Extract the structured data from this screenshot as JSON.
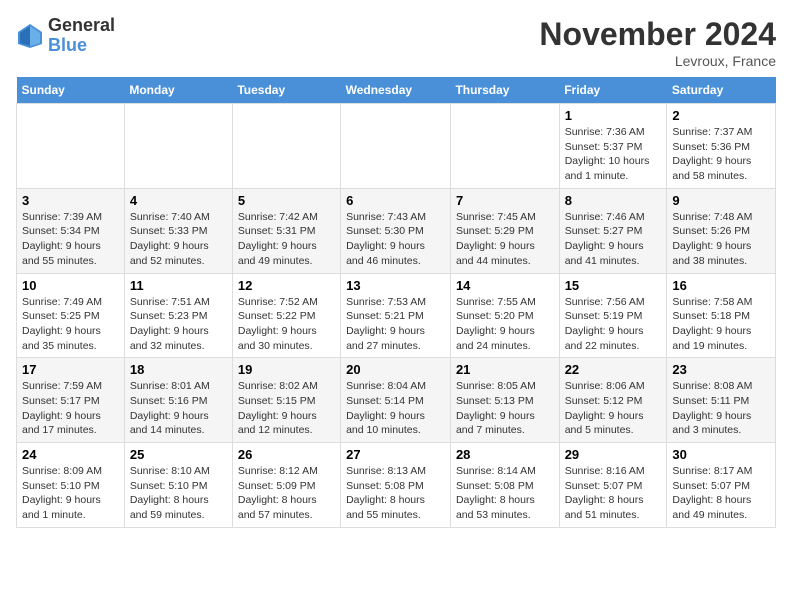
{
  "header": {
    "logo_line1": "General",
    "logo_line2": "Blue",
    "month_title": "November 2024",
    "location": "Levroux, France"
  },
  "weekdays": [
    "Sunday",
    "Monday",
    "Tuesday",
    "Wednesday",
    "Thursday",
    "Friday",
    "Saturday"
  ],
  "weeks": [
    [
      {
        "day": "",
        "info": ""
      },
      {
        "day": "",
        "info": ""
      },
      {
        "day": "",
        "info": ""
      },
      {
        "day": "",
        "info": ""
      },
      {
        "day": "",
        "info": ""
      },
      {
        "day": "1",
        "info": "Sunrise: 7:36 AM\nSunset: 5:37 PM\nDaylight: 10 hours and 1 minute."
      },
      {
        "day": "2",
        "info": "Sunrise: 7:37 AM\nSunset: 5:36 PM\nDaylight: 9 hours and 58 minutes."
      }
    ],
    [
      {
        "day": "3",
        "info": "Sunrise: 7:39 AM\nSunset: 5:34 PM\nDaylight: 9 hours and 55 minutes."
      },
      {
        "day": "4",
        "info": "Sunrise: 7:40 AM\nSunset: 5:33 PM\nDaylight: 9 hours and 52 minutes."
      },
      {
        "day": "5",
        "info": "Sunrise: 7:42 AM\nSunset: 5:31 PM\nDaylight: 9 hours and 49 minutes."
      },
      {
        "day": "6",
        "info": "Sunrise: 7:43 AM\nSunset: 5:30 PM\nDaylight: 9 hours and 46 minutes."
      },
      {
        "day": "7",
        "info": "Sunrise: 7:45 AM\nSunset: 5:29 PM\nDaylight: 9 hours and 44 minutes."
      },
      {
        "day": "8",
        "info": "Sunrise: 7:46 AM\nSunset: 5:27 PM\nDaylight: 9 hours and 41 minutes."
      },
      {
        "day": "9",
        "info": "Sunrise: 7:48 AM\nSunset: 5:26 PM\nDaylight: 9 hours and 38 minutes."
      }
    ],
    [
      {
        "day": "10",
        "info": "Sunrise: 7:49 AM\nSunset: 5:25 PM\nDaylight: 9 hours and 35 minutes."
      },
      {
        "day": "11",
        "info": "Sunrise: 7:51 AM\nSunset: 5:23 PM\nDaylight: 9 hours and 32 minutes."
      },
      {
        "day": "12",
        "info": "Sunrise: 7:52 AM\nSunset: 5:22 PM\nDaylight: 9 hours and 30 minutes."
      },
      {
        "day": "13",
        "info": "Sunrise: 7:53 AM\nSunset: 5:21 PM\nDaylight: 9 hours and 27 minutes."
      },
      {
        "day": "14",
        "info": "Sunrise: 7:55 AM\nSunset: 5:20 PM\nDaylight: 9 hours and 24 minutes."
      },
      {
        "day": "15",
        "info": "Sunrise: 7:56 AM\nSunset: 5:19 PM\nDaylight: 9 hours and 22 minutes."
      },
      {
        "day": "16",
        "info": "Sunrise: 7:58 AM\nSunset: 5:18 PM\nDaylight: 9 hours and 19 minutes."
      }
    ],
    [
      {
        "day": "17",
        "info": "Sunrise: 7:59 AM\nSunset: 5:17 PM\nDaylight: 9 hours and 17 minutes."
      },
      {
        "day": "18",
        "info": "Sunrise: 8:01 AM\nSunset: 5:16 PM\nDaylight: 9 hours and 14 minutes."
      },
      {
        "day": "19",
        "info": "Sunrise: 8:02 AM\nSunset: 5:15 PM\nDaylight: 9 hours and 12 minutes."
      },
      {
        "day": "20",
        "info": "Sunrise: 8:04 AM\nSunset: 5:14 PM\nDaylight: 9 hours and 10 minutes."
      },
      {
        "day": "21",
        "info": "Sunrise: 8:05 AM\nSunset: 5:13 PM\nDaylight: 9 hours and 7 minutes."
      },
      {
        "day": "22",
        "info": "Sunrise: 8:06 AM\nSunset: 5:12 PM\nDaylight: 9 hours and 5 minutes."
      },
      {
        "day": "23",
        "info": "Sunrise: 8:08 AM\nSunset: 5:11 PM\nDaylight: 9 hours and 3 minutes."
      }
    ],
    [
      {
        "day": "24",
        "info": "Sunrise: 8:09 AM\nSunset: 5:10 PM\nDaylight: 9 hours and 1 minute."
      },
      {
        "day": "25",
        "info": "Sunrise: 8:10 AM\nSunset: 5:10 PM\nDaylight: 8 hours and 59 minutes."
      },
      {
        "day": "26",
        "info": "Sunrise: 8:12 AM\nSunset: 5:09 PM\nDaylight: 8 hours and 57 minutes."
      },
      {
        "day": "27",
        "info": "Sunrise: 8:13 AM\nSunset: 5:08 PM\nDaylight: 8 hours and 55 minutes."
      },
      {
        "day": "28",
        "info": "Sunrise: 8:14 AM\nSunset: 5:08 PM\nDaylight: 8 hours and 53 minutes."
      },
      {
        "day": "29",
        "info": "Sunrise: 8:16 AM\nSunset: 5:07 PM\nDaylight: 8 hours and 51 minutes."
      },
      {
        "day": "30",
        "info": "Sunrise: 8:17 AM\nSunset: 5:07 PM\nDaylight: 8 hours and 49 minutes."
      }
    ]
  ]
}
